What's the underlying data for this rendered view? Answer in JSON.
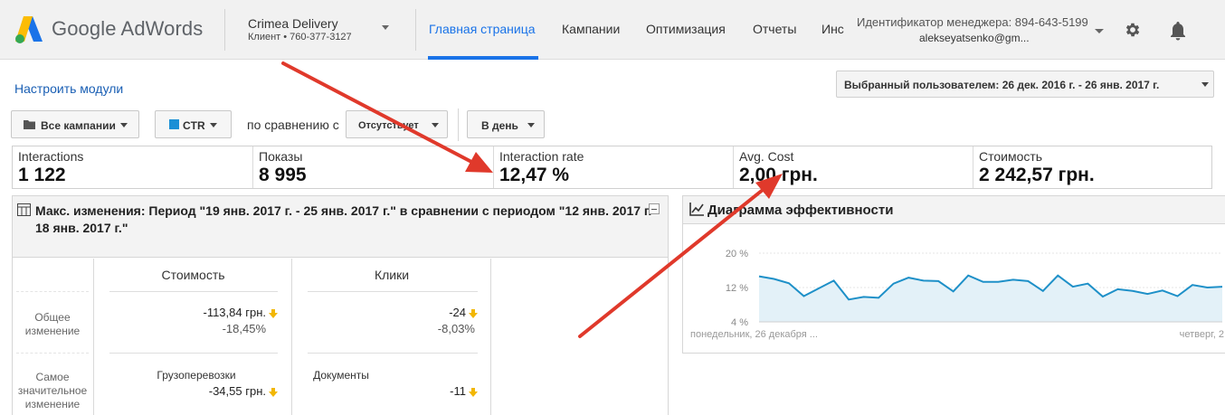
{
  "header": {
    "logo_text": "Google AdWords",
    "account_name": "Crimea Delivery",
    "account_sub": "Клиент  •  760-377-3127",
    "nav": [
      {
        "label": "Главная страница",
        "active": true
      },
      {
        "label": "Кампании"
      },
      {
        "label": "Оптимизация"
      },
      {
        "label": "Отчеты"
      },
      {
        "label": "Инс"
      }
    ],
    "manager_id": "Идентификатор менеджера: 894-643-5199",
    "manager_email": "alekseyatsenko@gm...",
    "icons": [
      "settings-gear-icon",
      "notifications-bell-icon"
    ]
  },
  "toolbar": {
    "customize_link": "Настроить модули",
    "date_range": "Выбранный пользователем: 26 дек. 2016 г. - 26 янв. 2017 г."
  },
  "filters": {
    "campaigns": "Все кампании",
    "metric": "CTR",
    "metric_color": "#1a8fd6",
    "compare_label": "по сравнению с",
    "compare_value": "Отсутствует",
    "granularity": "В день"
  },
  "metrics": [
    {
      "label": "Interactions",
      "value": "1 122"
    },
    {
      "label": "Показы",
      "value": "8 995"
    },
    {
      "label": "Interaction rate",
      "value": "12,47 %"
    },
    {
      "label": "Avg. Cost",
      "value": "2,00 грн."
    },
    {
      "label": "Стоимость",
      "value": "2 242,57 грн."
    }
  ],
  "changes": {
    "title": "Макс. изменения: Период \"19 янв. 2017 г. - 25 янв. 2017 г.\" в сравнении с периодом \"12 янв. 2017 г. - 18 янв. 2017 г.\"",
    "row_labels": [
      "Общее изменение",
      "Самое значительное изменение"
    ],
    "columns": [
      {
        "header": "Стоимость",
        "total_value": "-113,84 грн.",
        "total_percent": "-18,45%",
        "top_category": "Грузоперевозки",
        "top_value": "-34,55 грн."
      },
      {
        "header": "Клики",
        "total_value": "-24",
        "total_percent": "-8,03%",
        "top_category": "Документы",
        "top_value": "-11"
      }
    ],
    "down_arrow_color": "#f2b705"
  },
  "performance": {
    "title": "Диаграмма эффективности",
    "chart_data": {
      "type": "area",
      "y_ticks": [
        "20 %",
        "12 %",
        "4 %"
      ],
      "ylim": [
        4,
        20
      ],
      "x_labels": [
        "понедельник, 26 декабря ...",
        "четверг, 2"
      ],
      "series": [
        {
          "values": [
            14.6,
            14.0,
            13.0,
            10.0,
            11.8,
            13.6,
            9.2,
            9.8,
            9.6,
            12.9,
            14.3,
            13.6,
            13.5,
            11.1,
            14.8,
            13.3,
            13.3,
            13.8,
            13.5,
            11.2,
            14.8,
            12.2,
            12.9,
            9.9,
            11.6,
            11.2,
            10.5,
            11.3,
            10.0,
            12.6,
            12.0,
            12.2
          ],
          "line_color": "#1e90c8",
          "fill_color": "#e3f1f8"
        }
      ]
    }
  },
  "annotation_color": "#e0392b"
}
